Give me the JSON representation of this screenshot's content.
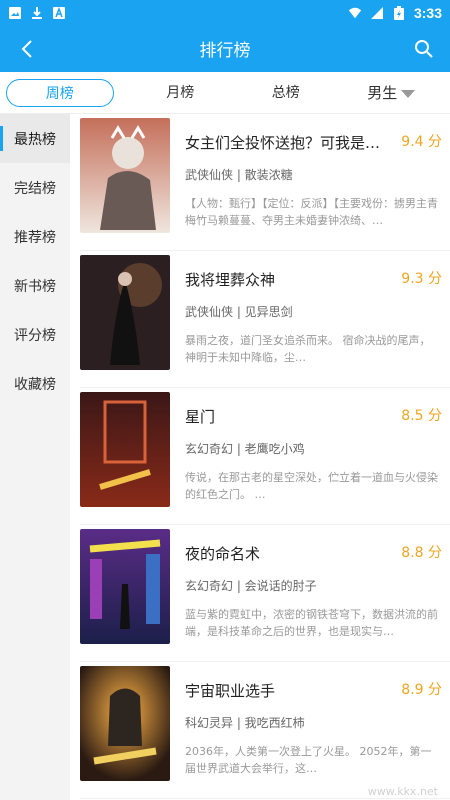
{
  "status_bar": {
    "time": "3:33",
    "icons": [
      "image-icon",
      "download-icon",
      "font-icon",
      "wifi-icon",
      "signal-icon",
      "battery-icon"
    ]
  },
  "app_bar": {
    "title": "排行榜",
    "back_icon": "back-icon",
    "search_icon": "search-icon"
  },
  "tabs": {
    "weekly": "周榜",
    "monthly": "月榜",
    "total": "总榜",
    "gender": "男生"
  },
  "sidebar": {
    "items": [
      "最热榜",
      "完结榜",
      "推荐榜",
      "新书榜",
      "评分榜",
      "收藏榜"
    ]
  },
  "books": [
    {
      "title": "女主们全投怀送抱？可我是反派…",
      "score": "9.4 分",
      "meta": "武侠仙侠 | 散装浓糖",
      "desc": "【人物：甄行】【定位：反派】【主要戏份：掳男主青梅竹马赖蔓蔓、夺男主未婚妻钟浓绮、…"
    },
    {
      "title": "我将埋葬众神",
      "score": "9.3 分",
      "meta": "武侠仙侠 | 见异思剑",
      "desc": "暴雨之夜，道门圣女追杀而来。 宿命决战的尾声，神明于未知中降临，尘…"
    },
    {
      "title": "星门",
      "score": "8.5 分",
      "meta": "玄幻奇幻 | 老鹰吃小鸡",
      "desc": "传说，在那古老的星空深处，伫立着一道血与火侵染的红色之门。 …"
    },
    {
      "title": "夜的命名术",
      "score": "8.8 分",
      "meta": "玄幻奇幻 | 会说话的肘子",
      "desc": "蓝与紫的霓虹中，浓密的钢铁苍穹下，数据洪流的前端，是科技革命之后的世界，也是现实与…"
    },
    {
      "title": "宇宙职业选手",
      "score": "8.9 分",
      "meta": "科幻灵异 | 我吃西红柿",
      "desc": "2036年，人类第一次登上了火星。 2052年，第一届世界武道大会举行，这…"
    }
  ],
  "watermark": "www.kkx.net",
  "colors": {
    "accent": "#1aa3f0",
    "score": "#f0a520"
  }
}
